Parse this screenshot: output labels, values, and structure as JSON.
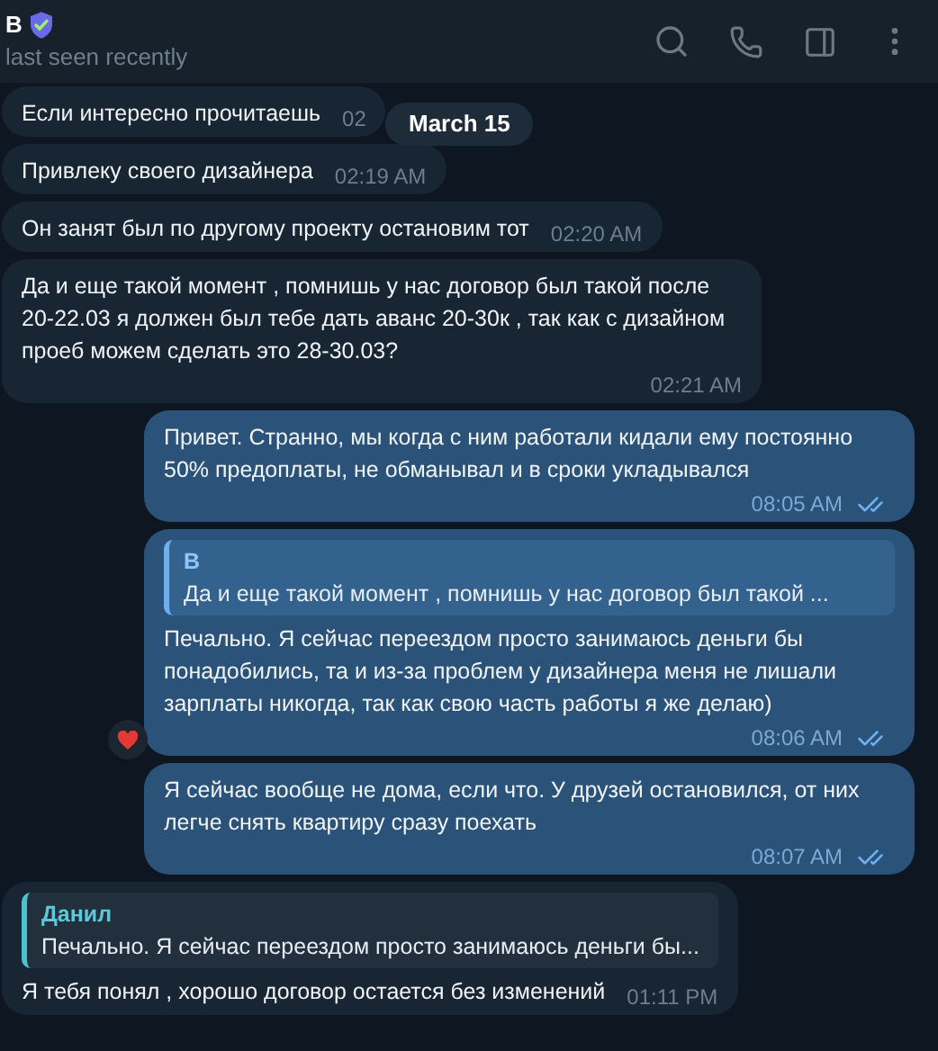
{
  "header": {
    "name": "B",
    "status": "last seen recently"
  },
  "date_pill": "March 15",
  "messages": [
    {
      "kind": "incoming",
      "text": "Если интересно прочитаешь",
      "time": "02"
    },
    {
      "kind": "incoming",
      "text": "Привлеку своего дизайнера",
      "time": "02:19 AM"
    },
    {
      "kind": "incoming",
      "text": "Он занят был по другому проекту остановим тот",
      "time": "02:20 AM"
    },
    {
      "kind": "incoming",
      "text": "Да и еще такой момент , помнишь у нас договор был такой после 20-22.03 я должен был тебе дать аванс 20-30к , так как с дизайном проеб можем сделать это 28-30.03?",
      "time": "02:21 AM"
    },
    {
      "kind": "outgoing",
      "text": "Привет. Странно, мы когда с ним работали кидали ему постоянно 50% предоплаты, не обманывал и в сроки укладывался",
      "time": "08:05 AM",
      "read": true,
      "reacted": false
    },
    {
      "kind": "outgoing",
      "reply": {
        "author": "B",
        "text": "Да и еще такой момент , помнишь у нас договор был такой ..."
      },
      "text": "Печально. Я сейчас переездом просто занимаюсь деньги бы понадобились, та и из-за проблем у дизайнера меня не лишали зарплаты никогда, так как свою часть работы я же делаю)",
      "time": "08:06 AM",
      "read": true,
      "reacted": true
    },
    {
      "kind": "outgoing",
      "text": "Я сейчас вообще не дома, если что. У друзей остановился, от них легче снять квартиру сразу поехать",
      "time": "08:07 AM",
      "read": true,
      "reacted": false
    },
    {
      "kind": "incoming",
      "reply": {
        "author": "Данил",
        "text": "Печально. Я сейчас переездом просто занимаюсь деньги бы..."
      },
      "text": "Я тебя понял , хорошо договор остается без изменений",
      "time": "01:11 PM"
    }
  ]
}
